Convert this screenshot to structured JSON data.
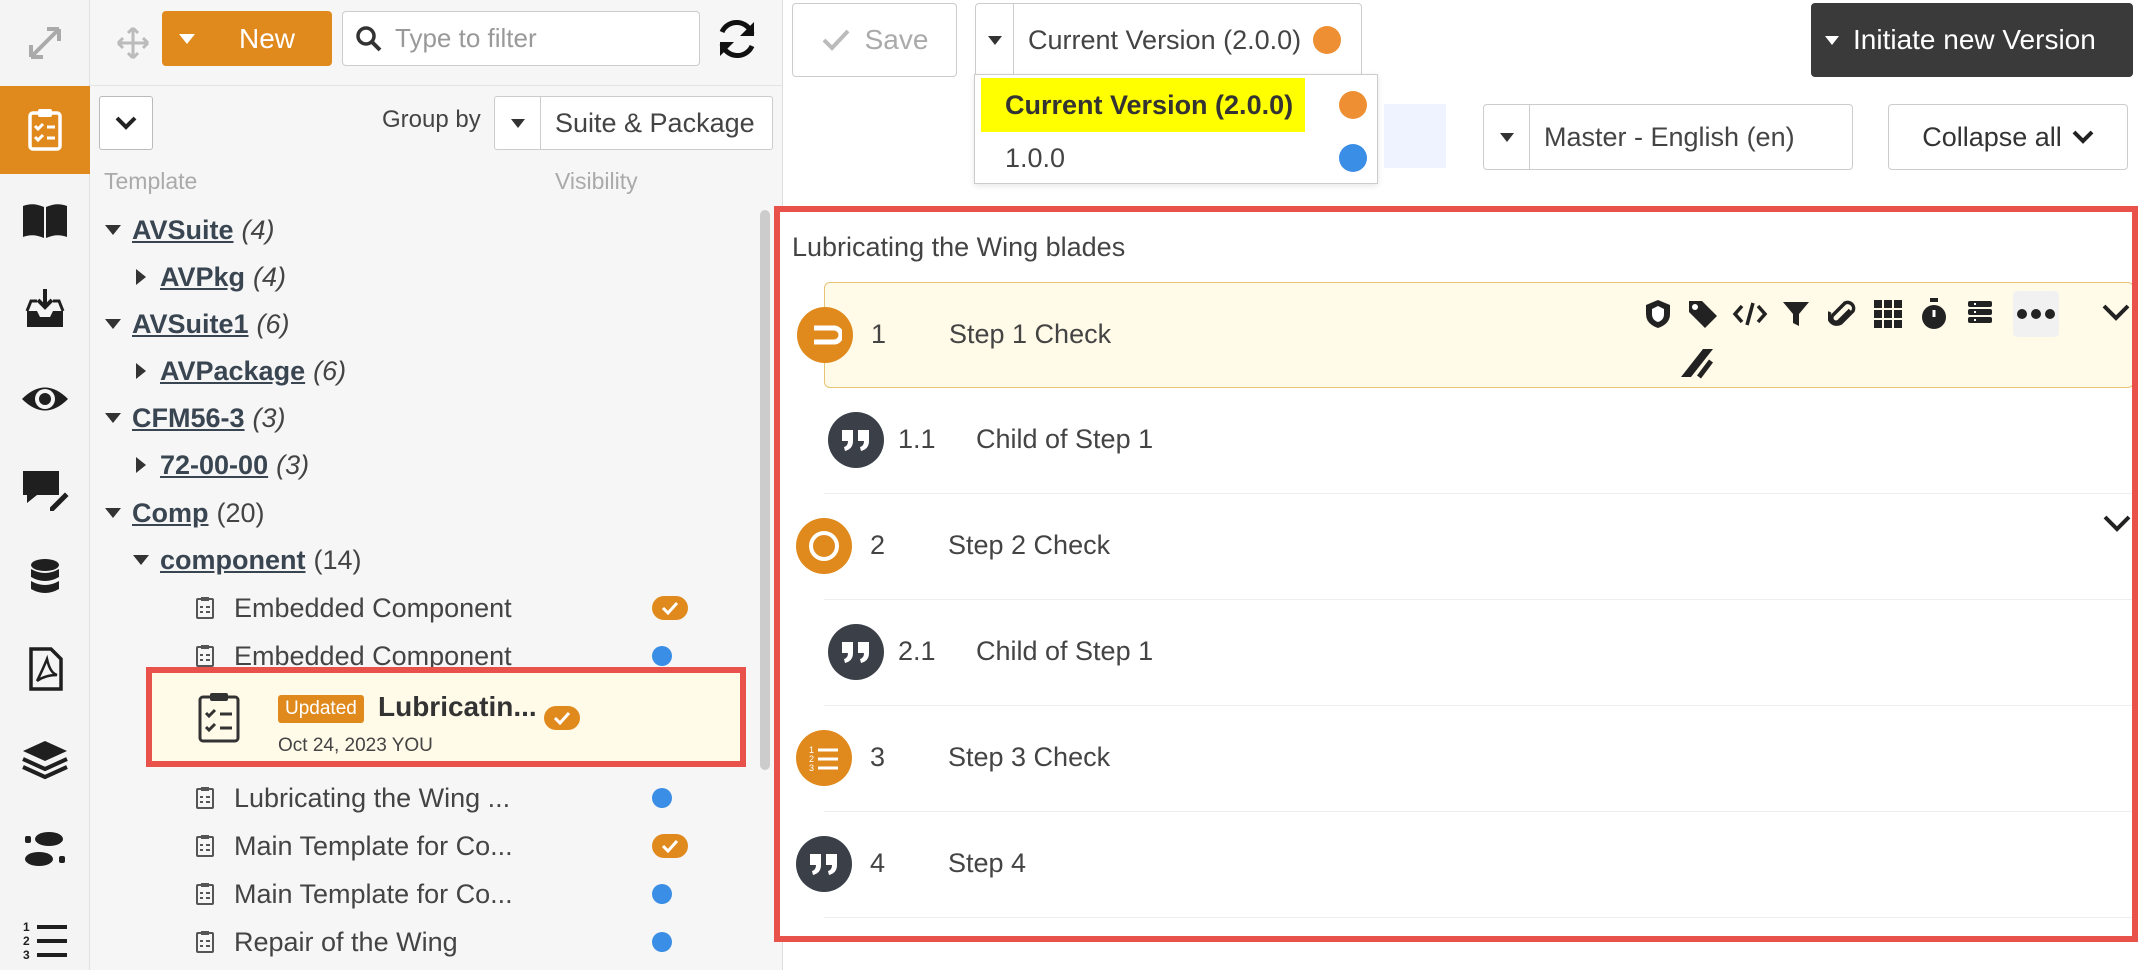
{
  "toolbar": {
    "new_label": "New",
    "filter_placeholder": "Type to filter",
    "save_label": "Save",
    "version_selected": "Current Version (2.0.0)",
    "initiate_label": "Initiate new Version"
  },
  "version_menu": {
    "options": [
      {
        "label": "Current Version (2.0.0)",
        "color": "#ee8f33"
      },
      {
        "label": "1.0.0",
        "color": "#3a8ee6"
      }
    ]
  },
  "panel": {
    "group_by_label": "Group by",
    "group_by_value": "Suite & Package",
    "col_template": "Template",
    "col_visibility": "Visibility"
  },
  "tree": {
    "nodes": [
      {
        "name": "AVSuite",
        "count": "(4)"
      },
      {
        "name": "AVPkg",
        "count": "(4)"
      },
      {
        "name": "AVSuite1",
        "count": "(6)"
      },
      {
        "name": "AVPackage",
        "count": "(6)"
      },
      {
        "name": "CFM56-3",
        "count": "(3)"
      },
      {
        "name": "72-00-00",
        "count": "(3)"
      },
      {
        "name": "Comp",
        "count": "(20)"
      },
      {
        "name": "component",
        "count": "(14)"
      }
    ],
    "leaves": [
      {
        "label": "Embedded Component",
        "visibility": "check"
      },
      {
        "label": "Embedded Component",
        "visibility": "blue"
      },
      {
        "label": "Lubricating the Wing ...",
        "visibility": "blue"
      },
      {
        "label": "Main Template for Co...",
        "visibility": "check"
      },
      {
        "label": "Main Template for Co...",
        "visibility": "blue"
      },
      {
        "label": "Repair of the Wing",
        "visibility": "blue"
      }
    ],
    "selected": {
      "badge": "Updated",
      "title": "Lubricatin...",
      "meta": "Oct 24, 2023  YOU"
    }
  },
  "main": {
    "language": "Master - English (en)",
    "collapse_all": "Collapse all",
    "template_title": "Lubricating the Wing blades",
    "steps": [
      {
        "num": "1",
        "title": "Step 1 Check"
      },
      {
        "num": "1.1",
        "title": "Child of Step 1"
      },
      {
        "num": "2",
        "title": "Step 2 Check"
      },
      {
        "num": "2.1",
        "title": "Child of Step 1"
      },
      {
        "num": "3",
        "title": "Step 3 Check"
      },
      {
        "num": "4",
        "title": "Step 4"
      }
    ]
  },
  "colors": {
    "accent": "#e08a1e",
    "highlight_border": "#e8524a",
    "dark": "#3b4048"
  }
}
